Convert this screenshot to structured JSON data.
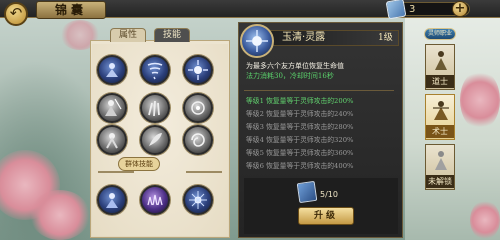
{
  "header": {
    "title": "锦囊",
    "currency_value": "3"
  },
  "tabs": [
    {
      "label": "属性",
      "selected": false
    },
    {
      "label": "技能",
      "selected": true
    }
  ],
  "skill_grid": {
    "section_label": "群体技能"
  },
  "detail": {
    "skill_name": "玉清·灵露",
    "skill_level": "1级",
    "description": "为最多六个友方单位恢复生命值",
    "stats": "法力消耗30，冷却时间16秒",
    "levels": [
      {
        "text": "等级1  恢复量等于灵师攻击的200%",
        "active": true
      },
      {
        "text": "等级2  恢复量等于灵师攻击的240%",
        "active": false
      },
      {
        "text": "等级3  恢复量等于灵师攻击的280%",
        "active": false
      },
      {
        "text": "等级4  恢复量等于灵师攻击的320%",
        "active": false
      },
      {
        "text": "等级5  恢复量等于灵师攻击的360%",
        "active": false
      },
      {
        "text": "等级6  恢复量等于灵师攻击的400%",
        "active": false
      }
    ],
    "book_count": "5/10",
    "upgrade_label": "升级"
  },
  "class_panel": {
    "header": "灵师职业",
    "classes": [
      {
        "label": "道士",
        "selected": false
      },
      {
        "label": "术士",
        "selected": true
      },
      {
        "label": "未解锁",
        "selected": false
      }
    ]
  },
  "colors": {
    "active_level": "#62d46f",
    "inactive_level": "#9a9a9a",
    "gold": "#c9b27a"
  }
}
